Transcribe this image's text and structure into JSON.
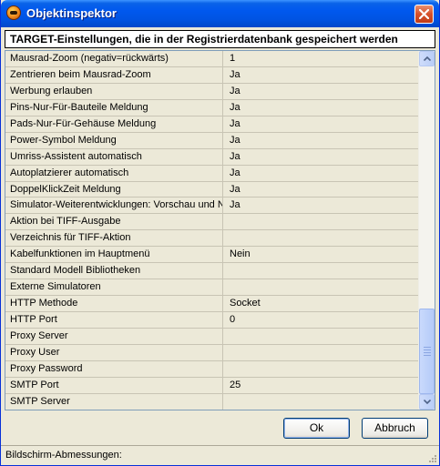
{
  "window": {
    "title": "Objektinspektor"
  },
  "header": {
    "text": "TARGET-Einstellungen, die in der Registrierdatenbank gespeichert werden"
  },
  "properties": [
    {
      "name": "Mausrad-Zoom (negativ=rückwärts)",
      "value": "1"
    },
    {
      "name": "Zentrieren beim Mausrad-Zoom",
      "value": "Ja"
    },
    {
      "name": "Werbung erlauben",
      "value": "Ja"
    },
    {
      "name": "Pins-Nur-Für-Bauteile Meldung",
      "value": "Ja"
    },
    {
      "name": "Pads-Nur-Für-Gehäuse Meldung",
      "value": "Ja"
    },
    {
      "name": "Power-Symbol Meldung",
      "value": "Ja"
    },
    {
      "name": "Umriss-Assistent automatisch",
      "value": "Ja"
    },
    {
      "name": "Autoplatzierer automatisch",
      "value": "Ja"
    },
    {
      "name": "DoppelKlickZeit Meldung",
      "value": "Ja"
    },
    {
      "name": "Simulator-Weiterentwicklungen: Vorschau und N",
      "value": "Ja"
    },
    {
      "name": "Aktion bei TIFF-Ausgabe",
      "value": ""
    },
    {
      "name": "Verzeichnis für TIFF-Aktion",
      "value": ""
    },
    {
      "name": "Kabelfunktionen im Hauptmenü",
      "value": "Nein"
    },
    {
      "name": "Standard Modell Bibliotheken",
      "value": ""
    },
    {
      "name": "Externe Simulatoren",
      "value": ""
    },
    {
      "name": "HTTP Methode",
      "value": "Socket"
    },
    {
      "name": "HTTP Port",
      "value": "0"
    },
    {
      "name": "Proxy Server",
      "value": ""
    },
    {
      "name": "Proxy User",
      "value": ""
    },
    {
      "name": "Proxy Password",
      "value": ""
    },
    {
      "name": "SMTP Port",
      "value": "25"
    },
    {
      "name": "SMTP Server",
      "value": ""
    }
  ],
  "buttons": {
    "ok": "Ok",
    "cancel": "Abbruch"
  },
  "status": {
    "text": "Bildschirm-Abmessungen:"
  }
}
